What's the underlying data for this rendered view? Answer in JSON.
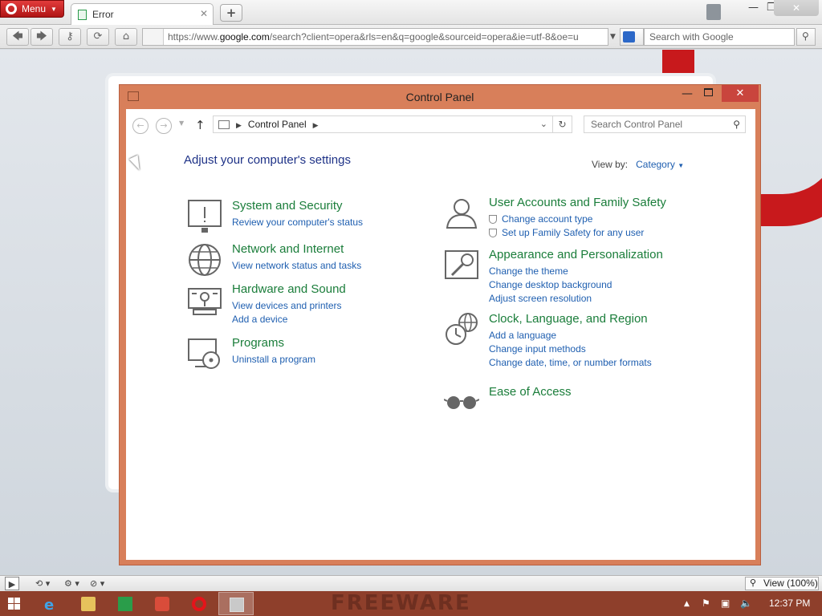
{
  "browser": {
    "menu_label": "Menu",
    "tab_title": "Error",
    "url_prefix": "https://www.",
    "url_domain": "google.com",
    "url_rest": "/search?client=opera&rls=en&q=google&sourceid=opera&ie=utf-8&oe=u",
    "search_placeholder": "Search with Google",
    "zoom_label": "View (100%)"
  },
  "control_panel": {
    "window_title": "Control Panel",
    "breadcrumb": "Control Panel",
    "search_placeholder": "Search Control Panel",
    "heading": "Adjust your computer's settings",
    "view_by_label": "View by:",
    "view_by_value": "Category",
    "categories_left": [
      {
        "title": "System and Security",
        "icon": "system-security-icon",
        "links": [
          "Review your computer's status"
        ]
      },
      {
        "title": "Network and Internet",
        "icon": "network-globe-icon",
        "links": [
          "View network status and tasks"
        ]
      },
      {
        "title": "Hardware and Sound",
        "icon": "hardware-sound-icon",
        "links": [
          "View devices and printers",
          "Add a device"
        ]
      },
      {
        "title": "Programs",
        "icon": "programs-icon",
        "links": [
          "Uninstall a program"
        ]
      }
    ],
    "categories_right": [
      {
        "title": "User Accounts and Family Safety",
        "icon": "user-accounts-icon",
        "links": [
          "Change account type",
          "Set up Family Safety for any user"
        ]
      },
      {
        "title": "Appearance and Personalization",
        "icon": "appearance-icon",
        "links": [
          "Change the theme",
          "Change desktop background",
          "Adjust screen resolution"
        ]
      },
      {
        "title": "Clock, Language, and Region",
        "icon": "clock-language-icon",
        "links": [
          "Add a language",
          "Change input methods",
          "Change date, time, or number formats"
        ]
      },
      {
        "title": "Ease of Access",
        "icon": "ease-of-access-icon",
        "links": []
      }
    ]
  },
  "taskbar": {
    "watermark": "FREEWARE",
    "clock": "12:37 PM"
  },
  "colors": {
    "window_frame": "#d87f5a",
    "category_title": "#1a7d3a",
    "link": "#1f5fb0",
    "taskbar": "#8e3f2b"
  }
}
